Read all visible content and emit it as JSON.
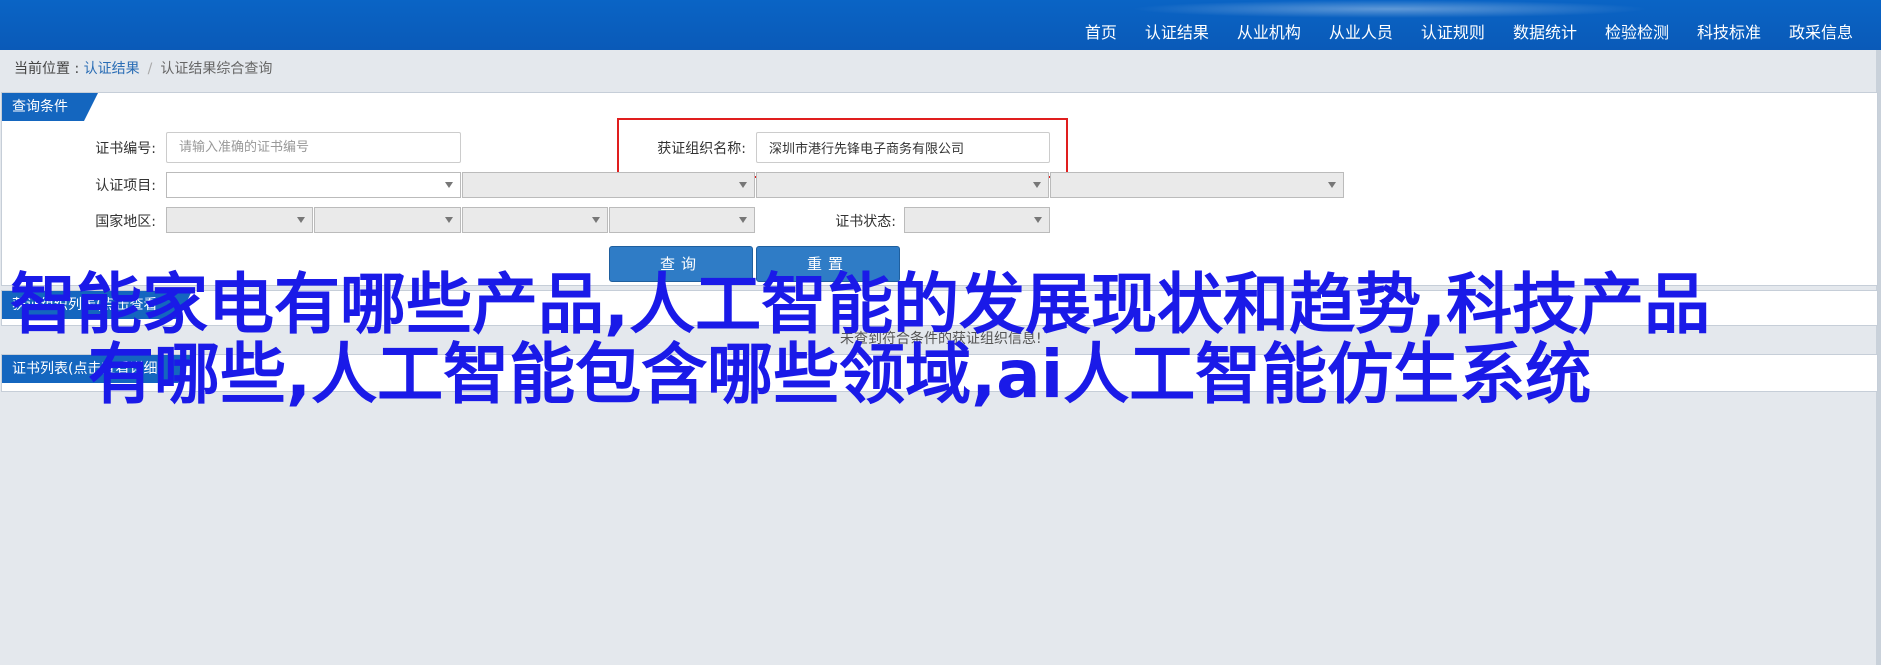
{
  "nav": [
    "首页",
    "认证结果",
    "从业机构",
    "从业人员",
    "认证规则",
    "数据统计",
    "检验检测",
    "科技标准",
    "政采信息"
  ],
  "breadcrumb": {
    "prefix": "当前位置 : ",
    "current": "认证结果",
    "separator": "/",
    "last": "认证结果综合查询"
  },
  "query_panel": {
    "title": "查询条件",
    "cert_no_label": "证书编号:",
    "cert_no_placeholder": "请输入准确的证书编号",
    "org_label": "获证组织名称:",
    "org_value": "深圳市港行先锋电子商务有限公司",
    "project_label": "认证项目:",
    "region_label": "国家地区:",
    "status_label": "证书状态:",
    "query_button": "查询",
    "reset_button": "重置"
  },
  "section1_title": "获证组织列表(点击查看详细信息)",
  "hint": "未查到符合条件的获证组织信息!",
  "section2_title": "证书列表(点击查看详细信息)",
  "overlay": {
    "line1": "智能家电有哪些产品,人工智能的发展现状和趋势,科技产品",
    "line2": "有哪些,人工智能包含哪些领域,ai人工智能仿生系统"
  },
  "colors": {
    "nav_bg": "#0a5ab8",
    "accent": "#1466bf",
    "overlay_text": "#1a1ae8",
    "highlight_box": "#e01e1e"
  }
}
